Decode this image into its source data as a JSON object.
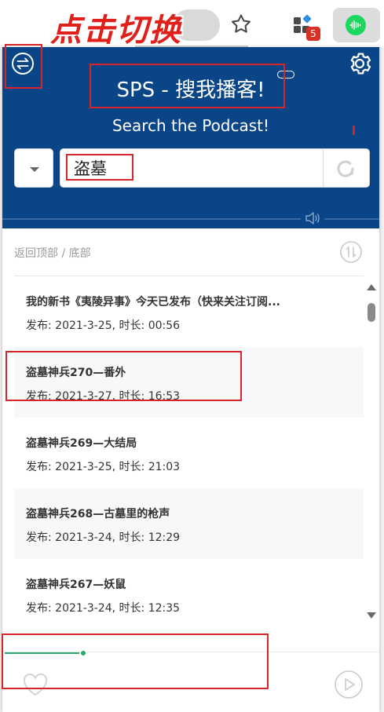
{
  "browser": {
    "banner_text": "点击切换",
    "extension_badge": "5"
  },
  "popup": {
    "title": "SPS - 搜我播客!",
    "subtitle": "Search the Podcast!",
    "search": {
      "value": "盗墓",
      "placeholder": ""
    },
    "nav_text": "返回顶部 / 底部",
    "episodes": [
      {
        "title": "我的新书《夷陵异事》今天已发布（快来关注订阅...",
        "date_label": "发布: 2021-3-25",
        "duration_label": "时长: 00:56"
      },
      {
        "title": "盗墓神兵270—番外",
        "date_label": "发布: 2021-3-27",
        "duration_label": "时长: 16:53"
      },
      {
        "title": "盗墓神兵269—大结局",
        "date_label": "发布: 2021-3-25",
        "duration_label": "时长: 21:03"
      },
      {
        "title": "盗墓神兵268—古墓里的枪声",
        "date_label": "发布: 2021-3-24",
        "duration_label": "时长: 12:29"
      },
      {
        "title": "盗墓神兵267—妖鼠",
        "date_label": "发布: 2021-3-24",
        "duration_label": "时长: 12:35"
      }
    ],
    "player": {
      "progress": 0.21
    }
  },
  "colors": {
    "header_bg": "#0a4687",
    "annotation_red": "#d8242b",
    "player_green": "#2ba66e"
  }
}
